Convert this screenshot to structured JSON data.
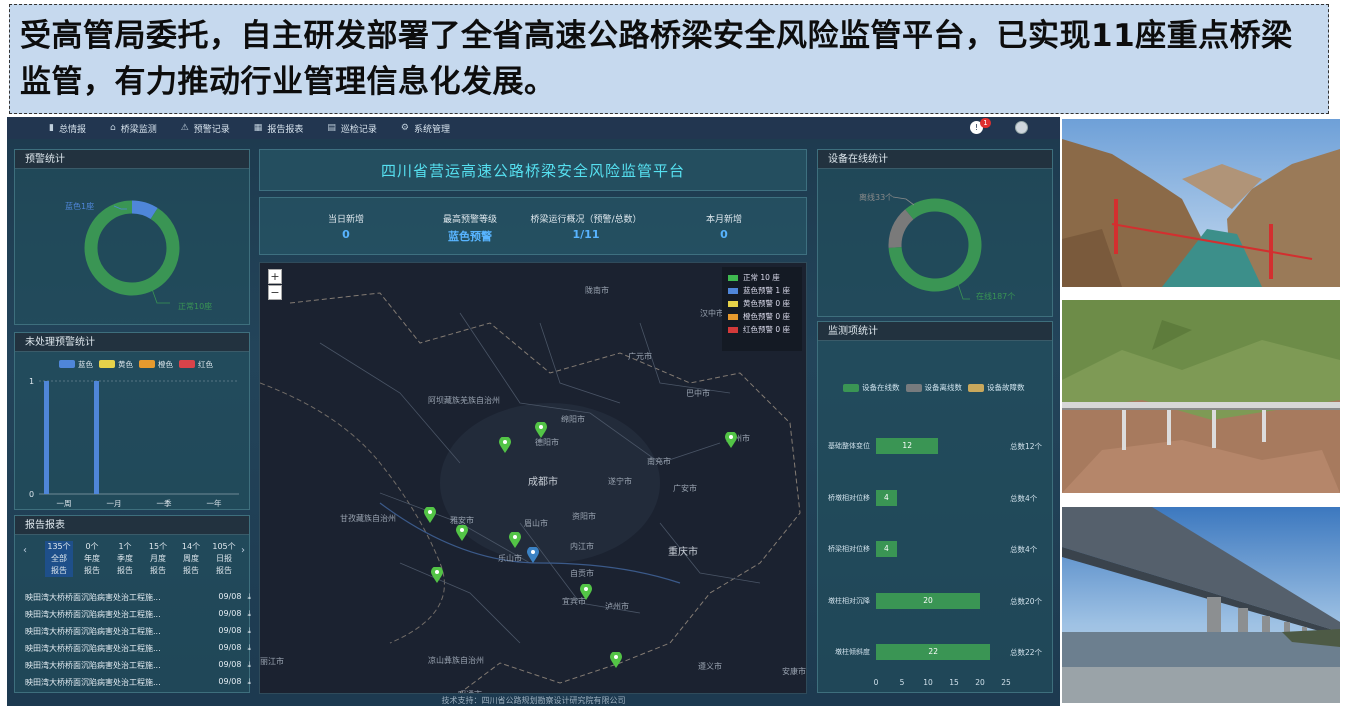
{
  "banner": {
    "text": "受高管局委托，自主研发部署了全省高速公路桥梁安全风险监管平台，已实现11座重点桥梁监管，有力推动行业管理信息化发展。"
  },
  "nav": {
    "items": [
      {
        "label": "总情报",
        "icon": "chart-icon",
        "glyph": "▮"
      },
      {
        "label": "桥梁监测",
        "icon": "bridge-icon",
        "glyph": "⌂"
      },
      {
        "label": "预警记录",
        "icon": "warning-icon",
        "glyph": "⚠"
      },
      {
        "label": "报告报表",
        "icon": "table-icon",
        "glyph": "▦"
      },
      {
        "label": "巡检记录",
        "icon": "document-icon",
        "glyph": "▤"
      },
      {
        "label": "系统管理",
        "icon": "gear-icon",
        "glyph": "⚙"
      }
    ],
    "notification_count": "1",
    "bell_glyph": "!"
  },
  "alert_stats": {
    "title": "预警统计",
    "blue_label": "蓝色1座",
    "normal_label": "正常10座",
    "donut": {
      "normal": 10,
      "blue": 1
    },
    "colors": {
      "normal": "#3a9554",
      "blue": "#4f86d9"
    }
  },
  "unhandled": {
    "title": "未处理预警统计",
    "legend": [
      {
        "label": "蓝色",
        "color": "#4f86d9"
      },
      {
        "label": "黄色",
        "color": "#e6d24a"
      },
      {
        "label": "橙色",
        "color": "#e69a2e"
      },
      {
        "label": "红色",
        "color": "#d9434a"
      }
    ],
    "y_ticks": [
      "1",
      "0"
    ],
    "x_ticks": [
      "一周",
      "一月",
      "一季",
      "一年"
    ],
    "values": [
      1,
      1,
      0,
      0
    ]
  },
  "reports": {
    "title": "报告报表",
    "prev": "‹",
    "next": "›",
    "tabs": [
      {
        "count": "135个",
        "line1": "全部",
        "line2": "报告"
      },
      {
        "count": "0个",
        "line1": "年度",
        "line2": "报告"
      },
      {
        "count": "1个",
        "line1": "季度",
        "line2": "报告"
      },
      {
        "count": "15个",
        "line1": "月度",
        "line2": "报告"
      },
      {
        "count": "14个",
        "line1": "周度",
        "line2": "报告"
      },
      {
        "count": "105个",
        "line1": "日报",
        "line2": "报告"
      }
    ],
    "rows": [
      {
        "title": "映田湾大桥桥面沉陷病害处治工程施...",
        "date": "09/08"
      },
      {
        "title": "映田湾大桥桥面沉陷病害处治工程施...",
        "date": "09/08"
      },
      {
        "title": "映田湾大桥桥面沉陷病害处治工程施...",
        "date": "09/08"
      },
      {
        "title": "映田湾大桥桥面沉陷病害处治工程施...",
        "date": "09/08"
      },
      {
        "title": "映田湾大桥桥面沉陷病害处治工程施...",
        "date": "09/08"
      },
      {
        "title": "映田湾大桥桥面沉陷病害处治工程施...",
        "date": "09/08"
      }
    ],
    "download_glyph": "⤓"
  },
  "center": {
    "title": "四川省营运高速公路桥梁安全风险监管平台",
    "stats": [
      {
        "label": "当日新增",
        "value": "0"
      },
      {
        "label": "最高预警等级",
        "value": "蓝色预警"
      },
      {
        "label": "桥梁运行概况（预警/总数）",
        "value": "1/11"
      },
      {
        "label": "本月新增",
        "value": "0"
      }
    ]
  },
  "map": {
    "zoom_in": "+",
    "zoom_out": "−",
    "legend": [
      {
        "label": "正常 10 座",
        "color": "#3fb950"
      },
      {
        "label": "蓝色预警 1 座",
        "color": "#4f86d9"
      },
      {
        "label": "黄色预警 0 座",
        "color": "#e6d24a"
      },
      {
        "label": "橙色预警 0 座",
        "color": "#e69a2e"
      },
      {
        "label": "红色预警 0 座",
        "color": "#d33a3a"
      }
    ],
    "cities": [
      "阿坝藏族羌族自治州",
      "成都市",
      "甘孜藏族自治州",
      "眉山市",
      "乐山市",
      "雅安市",
      "内江市",
      "自贡市",
      "宜宾市",
      "泸州市",
      "重庆市",
      "南充市",
      "广元市",
      "巴中市",
      "达州市",
      "遂宁市",
      "广安市",
      "绵阳市",
      "德阳市",
      "凉山彝族自治州",
      "汉中市",
      "陇南市",
      "遵义市",
      "昭通市",
      "丽江市",
      "安康市",
      "资阳市"
    ],
    "pin_colors": {
      "normal": "#53c446",
      "blue": "#3b82c4"
    }
  },
  "devices": {
    "title": "设备在线统计",
    "offline_label": "离线33个",
    "online_label": "在线187个",
    "donut": {
      "online": 187,
      "offline": 33
    },
    "colors": {
      "online": "#3a9554",
      "offline": "#7a7a7a"
    }
  },
  "monitor": {
    "title": "监测项统计",
    "legend": [
      {
        "label": "设备在线数",
        "color": "#3a9554"
      },
      {
        "label": "设备离线数",
        "color": "#777b7e"
      },
      {
        "label": "设备故障数",
        "color": "#c9a85c"
      }
    ],
    "rows": [
      {
        "label": "基础整体变位",
        "value": 12,
        "text": "12",
        "total": "总数12个"
      },
      {
        "label": "桥墩相对位移",
        "value": 4,
        "text": "4",
        "total": "总数4个"
      },
      {
        "label": "桥梁相对位移",
        "value": 4,
        "text": "4",
        "total": "总数4个"
      },
      {
        "label": "墩柱相对沉降",
        "value": 20,
        "text": "20",
        "total": "总数20个"
      },
      {
        "label": "墩柱倾斜度",
        "value": 22,
        "text": "22",
        "total": "总数22个"
      }
    ],
    "x_ticks": [
      "0",
      "5",
      "10",
      "15",
      "20",
      "25"
    ],
    "x_max": 25
  },
  "footer": "技术支持：四川省公路规划勘察设计研究院有限公司"
}
